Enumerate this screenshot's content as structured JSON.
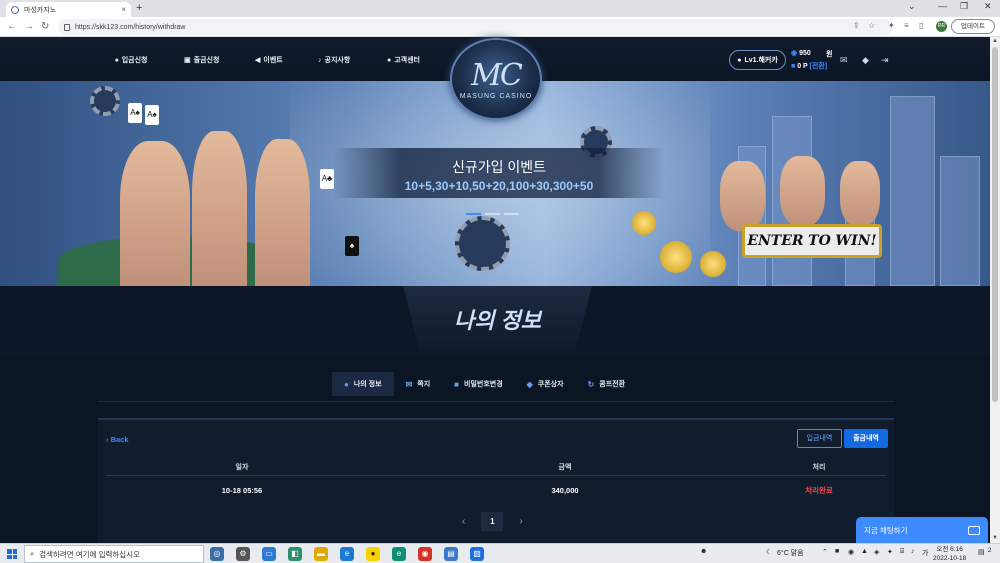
{
  "browser": {
    "tab_title": "마성카지노",
    "tab_close": "×",
    "new_tab": "+",
    "url": "https://skk123.com/history/withdraw",
    "update_label": "업데이트",
    "profile_initials": "RR"
  },
  "header": {
    "menu": [
      {
        "label": "입금신청",
        "icon": "spade-icon"
      },
      {
        "label": "출금신청",
        "icon": "wallet-icon"
      },
      {
        "label": "이벤트",
        "icon": "megaphone-icon"
      },
      {
        "label": "공지사항",
        "icon": "bell-icon"
      },
      {
        "label": "고객센터",
        "icon": "chat-icon"
      }
    ],
    "logo_mark": "MC",
    "logo_text": "MASUNG CASINO",
    "level_label": "Lv1.해커카",
    "balance_amount": "950",
    "balance_unit": "원",
    "point_amount": "0 P",
    "point_convert": "[전환]"
  },
  "banner": {
    "event_title": "신규가입 이벤트",
    "event_detail": "10+5,30+10,50+20,100+30,300+50",
    "slot_words": [
      "ENTER",
      "TO",
      "WIN!"
    ],
    "active_slide": 0,
    "slide_count": 3
  },
  "page": {
    "title": "나의 정보",
    "subnav": [
      {
        "label": "나의 정보",
        "icon": "user-icon",
        "active": true
      },
      {
        "label": "쪽지",
        "icon": "envelope-icon",
        "active": false
      },
      {
        "label": "비밀번호변경",
        "icon": "lock-icon",
        "active": false
      },
      {
        "label": "쿠폰상자",
        "icon": "tag-icon",
        "active": false
      },
      {
        "label": "콤프전환",
        "icon": "refresh-icon",
        "active": false
      }
    ]
  },
  "history": {
    "back_label": "Back",
    "tab_deposit": "입금내역",
    "tab_withdraw": "출금내역",
    "columns": [
      "일자",
      "금액",
      "처리"
    ],
    "rows": [
      {
        "date": "10-18 05:56",
        "amount": "340,000",
        "status": "처리완료"
      }
    ],
    "current_page": "1"
  },
  "chat": {
    "label": "지금 채팅하기"
  },
  "taskbar": {
    "search_placeholder": "검색하려면 여기에 입력하십시오",
    "weather": "6°C 맑음",
    "time": "오전 6:16",
    "date": "2022-10-18",
    "notification_count": "2"
  },
  "colors": {
    "accent": "#3d8bff",
    "status_done": "#ff4848",
    "page_bg": "#0c1524"
  }
}
